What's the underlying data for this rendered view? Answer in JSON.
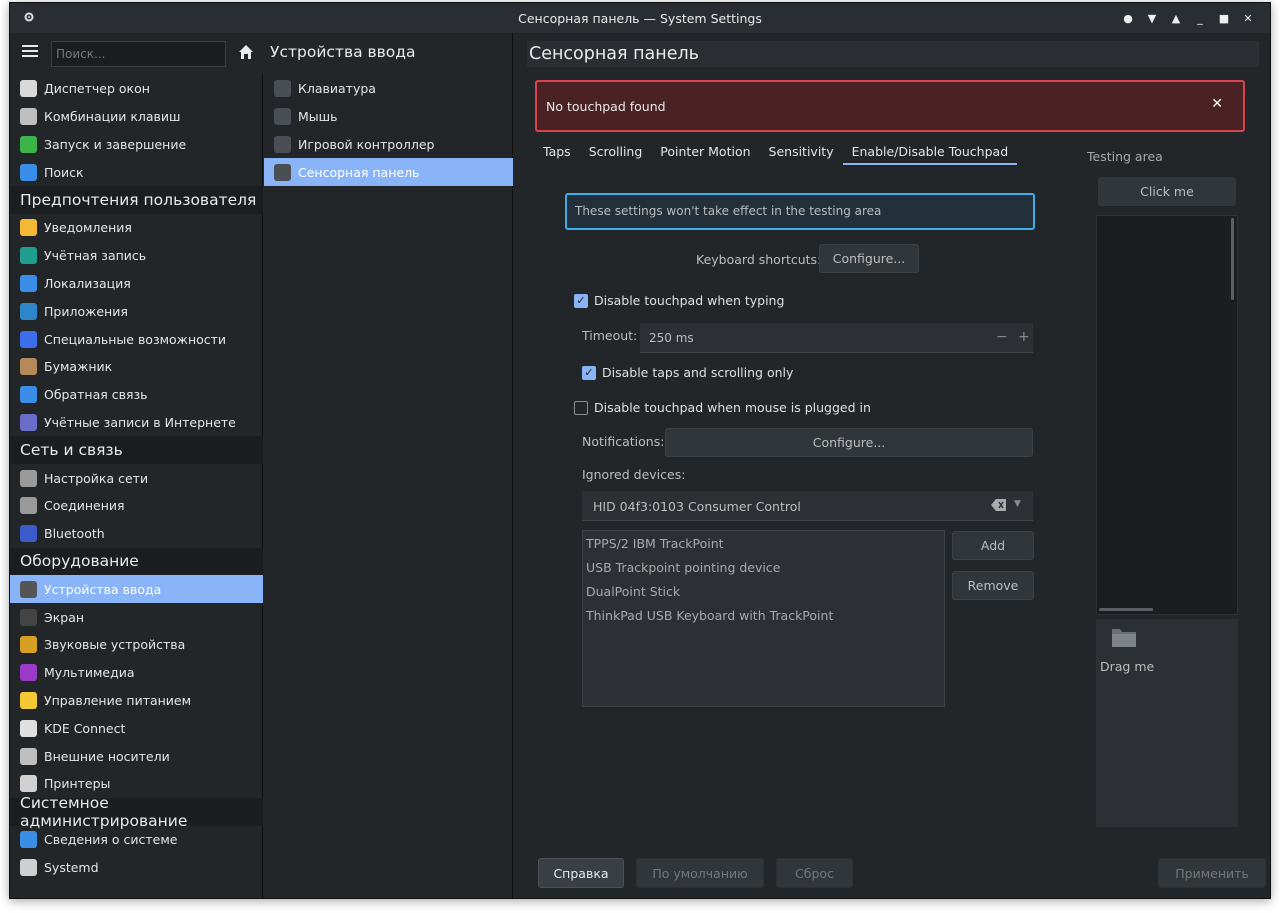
{
  "window": {
    "title": "Сенсорная панель — System Settings"
  },
  "sidebar": {
    "search_placeholder": "Поиск...",
    "items": [
      {
        "type": "item",
        "label": "Диспетчер окон",
        "icon": "window-manager-icon",
        "color": "#d9d9d9"
      },
      {
        "type": "item",
        "label": "Комбинации клавиш",
        "icon": "keyboard-shortcuts-icon",
        "color": "#bfbfbf"
      },
      {
        "type": "item",
        "label": "Запуск и завершение",
        "icon": "startup-icon",
        "color": "#3bb54a"
      },
      {
        "type": "item",
        "label": "Поиск",
        "icon": "search-icon",
        "color": "#3b8ee8"
      },
      {
        "type": "category",
        "label": "Предпочтения пользователя"
      },
      {
        "type": "item",
        "label": "Уведомления",
        "icon": "bell-icon",
        "color": "#f5b935"
      },
      {
        "type": "item",
        "label": "Учётная запись",
        "icon": "user-icon",
        "color": "#1f9d8f"
      },
      {
        "type": "item",
        "label": "Локализация",
        "icon": "localization-icon",
        "color": "#3b8ee8"
      },
      {
        "type": "item",
        "label": "Приложения",
        "icon": "applications-icon",
        "color": "#2c86c8"
      },
      {
        "type": "item",
        "label": "Специальные возможности",
        "icon": "accessibility-icon",
        "color": "#3b6ee8"
      },
      {
        "type": "item",
        "label": "Бумажник",
        "icon": "wallet-icon",
        "color": "#b58a5a"
      },
      {
        "type": "item",
        "label": "Обратная связь",
        "icon": "feedback-icon",
        "color": "#3b8ee8"
      },
      {
        "type": "item",
        "label": "Учётные записи в Интернете",
        "icon": "online-accounts-icon",
        "color": "#6b6ec8"
      },
      {
        "type": "category",
        "label": "Сеть и связь"
      },
      {
        "type": "item",
        "label": "Настройка сети",
        "icon": "network-settings-icon",
        "color": "#9a9a9a"
      },
      {
        "type": "item",
        "label": "Соединения",
        "icon": "connections-icon",
        "color": "#9a9a9a"
      },
      {
        "type": "item",
        "label": "Bluetooth",
        "icon": "bluetooth-icon",
        "color": "#3b5bc8"
      },
      {
        "type": "category",
        "label": "Оборудование"
      },
      {
        "type": "item",
        "label": "Устройства ввода",
        "icon": "mouse-icon",
        "color": "#555",
        "selected": true
      },
      {
        "type": "item",
        "label": "Экран",
        "icon": "monitor-icon",
        "color": "#444"
      },
      {
        "type": "item",
        "label": "Звуковые устройства",
        "icon": "audio-icon",
        "color": "#d8a022"
      },
      {
        "type": "item",
        "label": "Мультимедиа",
        "icon": "multimedia-icon",
        "color": "#9a3bc8"
      },
      {
        "type": "item",
        "label": "Управление питанием",
        "icon": "power-icon",
        "color": "#f5c935"
      },
      {
        "type": "item",
        "label": "KDE Connect",
        "icon": "kde-connect-icon",
        "color": "#e0e0e0"
      },
      {
        "type": "item",
        "label": "Внешние носители",
        "icon": "removable-media-icon",
        "color": "#bfbfbf"
      },
      {
        "type": "item",
        "label": "Принтеры",
        "icon": "printer-icon",
        "color": "#d0d0d0"
      },
      {
        "type": "category",
        "label": "Системное администрирование"
      },
      {
        "type": "item",
        "label": "Сведения о системе",
        "icon": "info-icon",
        "color": "#3b8ee8"
      },
      {
        "type": "item",
        "label": "Systemd",
        "icon": "systemd-icon",
        "color": "#cfcfcf"
      }
    ]
  },
  "middle": {
    "title": "Устройства ввода",
    "items": [
      {
        "label": "Клавиатура",
        "icon": "keyboard-icon"
      },
      {
        "label": "Мышь",
        "icon": "mouse-icon"
      },
      {
        "label": "Игровой контроллер",
        "icon": "gamepad-icon"
      },
      {
        "label": "Сенсорная панель",
        "icon": "touchpad-icon",
        "selected": true
      }
    ]
  },
  "main": {
    "page_title": "Сенсорная панель",
    "error": "No touchpad found",
    "tabs": [
      "Taps",
      "Scrolling",
      "Pointer Motion",
      "Sensitivity",
      "Enable/Disable Touchpad"
    ],
    "active_tab": 4,
    "note": "These settings won't take effect in the testing area",
    "keyboard_shortcuts_label": "Keyboard shortcuts:",
    "configure_label": "Configure...",
    "disable_typing_label": "Disable touchpad when typing",
    "disable_typing_checked": true,
    "timeout_label": "Timeout:",
    "timeout_value": "250 ms",
    "minus": "−",
    "plus": "+",
    "disable_taps_label": "Disable taps and scrolling only",
    "disable_taps_checked": true,
    "disable_mouse_label": "Disable touchpad when mouse is plugged in",
    "disable_mouse_checked": false,
    "notifications_label": "Notifications:",
    "notifications_configure": "Configure...",
    "ignored_label": "Ignored devices:",
    "ignored_combo_value": "HID 04f3:0103 Consumer Control",
    "ignored_list": [
      "TPPS/2 IBM TrackPoint",
      "USB Trackpoint pointing device",
      "DualPoint Stick",
      "ThinkPad USB Keyboard with TrackPoint"
    ],
    "add_label": "Add",
    "remove_label": "Remove",
    "testing_label": "Testing area",
    "click_me": "Click me",
    "drag_me": "Drag me"
  },
  "footer": {
    "help": "Справка",
    "defaults": "По умолчанию",
    "reset": "Сброс",
    "apply": "Применить"
  },
  "colors": {
    "accent": "#8ab4f8",
    "error_border": "#d9434b",
    "error_bg": "#4a2226",
    "note_border": "#3daee9"
  }
}
